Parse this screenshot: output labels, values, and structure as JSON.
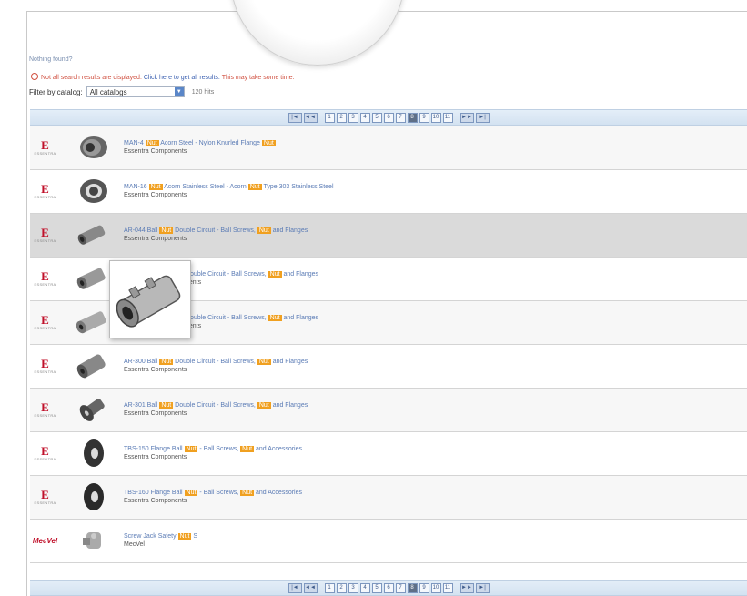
{
  "header": {
    "nothing_found": "Nothing found?",
    "warning_text": "Not all search results are displayed.",
    "warning_link": "Click here to get all results.",
    "warning_tail": "This may take some time.",
    "filter_label": "Filter by catalog:",
    "filter_value": "All catalogs",
    "hit_count": "120 hits"
  },
  "pager": {
    "first": "|◄",
    "prev": "◄◄",
    "pages": [
      "1",
      "2",
      "3",
      "4",
      "5",
      "6",
      "7",
      "8",
      "9",
      "10",
      "11"
    ],
    "current": "8",
    "next": "►►",
    "last": "►|"
  },
  "results": [
    {
      "brand": "Essentra",
      "title": "MAN-4",
      "title_rest": "Acorn Steel - Nylon Knurled Flange",
      "highlight": "Nut",
      "subtitle": "Essentra Components",
      "style": "shade"
    },
    {
      "brand": "Essentra",
      "title": "MAN-16",
      "title_rest": "Acorn Stainless Steel - Acorn",
      "title_tail": "Type 303 Stainless Steel",
      "highlight": "Nut",
      "subtitle": "Essentra Components",
      "style": "alt"
    },
    {
      "brand": "Essentra",
      "title": "AR-044 Ball",
      "title_rest": "Double Circuit - Ball Screws,",
      "title_tail": "and Flanges",
      "highlight": "Nut",
      "subtitle": "Essentra Components",
      "style": "hl"
    },
    {
      "brand": "Essentra",
      "title": "",
      "title_rest": "Double Circuit - Ball Screws,",
      "title_tail": "and Flanges",
      "highlight": "Nut",
      "subtitle": "nents",
      "style": "alt"
    },
    {
      "brand": "Essentra",
      "title": "",
      "title_rest": "Double Circuit - Ball Screws,",
      "title_tail": "and Flanges",
      "highlight": "Nut",
      "subtitle": "nents",
      "style": "shade"
    },
    {
      "brand": "Essentra",
      "title": "AR-300 Ball",
      "title_rest": "Double Circuit - Ball Screws,",
      "title_tail": "and Flanges",
      "highlight": "Nut",
      "subtitle": "Essentra Components",
      "style": "alt"
    },
    {
      "brand": "Essentra",
      "title": "AR-301 Ball",
      "title_rest": "Double Circuit - Ball Screws,",
      "title_tail": "and Flanges",
      "highlight": "Nut",
      "subtitle": "Essentra Components",
      "style": "shade"
    },
    {
      "brand": "Essentra",
      "title": "TBS-150 Flange Ball",
      "title_rest": "- Ball Screws,",
      "title_tail": "and Accessories",
      "highlight": "Nut",
      "subtitle": "Essentra Components",
      "style": "alt"
    },
    {
      "brand": "Essentra",
      "title": "TBS-160 Flange Ball",
      "title_rest": "- Ball Screws,",
      "title_tail": "and Accessories",
      "highlight": "Nut",
      "subtitle": "Essentra Components",
      "style": "shade"
    },
    {
      "brand": "MecVel",
      "title": "Screw Jack Safety",
      "title_rest": "S",
      "title_tail": "",
      "highlight": "Nut",
      "subtitle": "MecVel",
      "style": "alt"
    }
  ],
  "colors": {
    "accent": "#5a7bb5",
    "highlight": "#f0a020",
    "brand": "#c0102a",
    "pager": "#d3e2f1"
  }
}
